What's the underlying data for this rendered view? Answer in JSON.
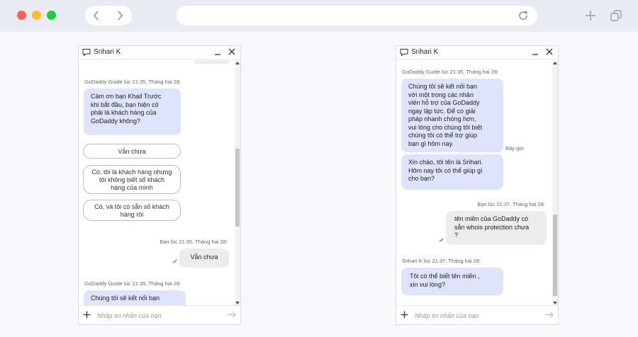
{
  "browser": {
    "url": "",
    "icons": [
      "back-icon",
      "forward-icon",
      "reload-icon",
      "new-tab-icon",
      "tabs-overview-icon"
    ]
  },
  "colors": {
    "agent_bubble": "#dfe3fb",
    "user_bubble": "#ececec",
    "close_dot": "#fe5f57",
    "minimize_dot": "#febc2e",
    "zoom_dot": "#28c840"
  },
  "left_chat": {
    "title": "Srihari K",
    "placeholder": "Nhập tin nhắn của bạn",
    "meta_1": "GoDaddy Guide lúc 21:35, Tháng hai 28:",
    "msg_1_lines": [
      "Cảm ơn bạn Khail Trước",
      "khi bắt đầu, bạn hiện có",
      "phải là khách hàng của",
      "GoDaddy không?"
    ],
    "option_1": "Vẫn chưa",
    "option_2_lines": [
      "Có, tôi là khách hàng nhưng",
      "tôi không biết số khách",
      "hàng của mình"
    ],
    "option_3_lines": [
      "Có, và tôi có sẵn số khách",
      "hàng rồi"
    ],
    "meta_2": "Bạn lúc 21:35, Tháng hai 28:",
    "user_msg_1": "Vẫn chưa",
    "meta_3": "GoDaddy Guide lúc 21:35, Tháng hai 28:",
    "msg_2_partial": "Chúng tôi sẽ kết nối bạn"
  },
  "right_chat": {
    "title": "Srihari K",
    "placeholder": "Nhập tin nhắn của bạn",
    "meta_1": "GoDaddy Guide lúc 21:35, Tháng hai 28:",
    "msg_1_lines": [
      "Chúng tôi sẽ kết nối bạn",
      "với một trong các nhân",
      "viên hỗ trợ của GoDaddy",
      "ngay lập tức. Để có giải",
      "pháp nhanh chóng hơn,",
      "vui lòng cho chúng tôi biết",
      "chúng tôi có thể trợ giúp",
      "bạn gì hôm nay."
    ],
    "timestamp_1": "Bây giờ",
    "msg_2_lines": [
      "Xin chào, tôi tên là Srihari.",
      "Hôm nay tôi có thể giúp gì",
      "cho bạn?"
    ],
    "meta_2": "Bạn lúc 21:37, Tháng hai 28:",
    "user_msg_lines": [
      "tên miền của GoDaddy có",
      "sẵn whois protection chưa",
      "?"
    ],
    "meta_3": "Srihari K lúc 21:37, Tháng hai 28:",
    "msg_3_lines": [
      "Tôi có thể biết tên miền ,",
      "xin vui lòng?"
    ]
  }
}
